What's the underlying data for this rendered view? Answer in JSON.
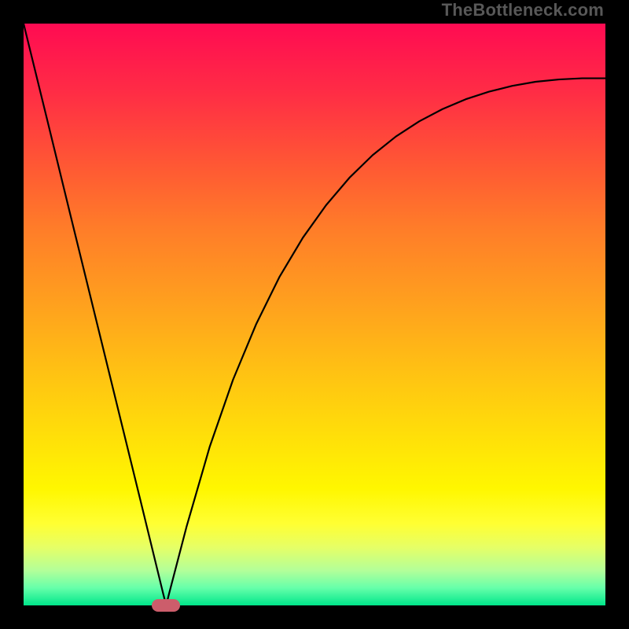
{
  "watermark": "TheBottleneck.com",
  "chart_data": {
    "type": "line",
    "title": "",
    "xlabel": "",
    "ylabel": "",
    "xlim": [
      0,
      100
    ],
    "ylim": [
      0,
      100
    ],
    "grid": false,
    "legend": false,
    "series": [
      {
        "name": "curve",
        "x": [
          0,
          4,
          8,
          12,
          16,
          20,
          24,
          24.5,
          25,
          28,
          32,
          36,
          40,
          44,
          48,
          52,
          56,
          60,
          64,
          68,
          72,
          76,
          80,
          84,
          88,
          92,
          96,
          100
        ],
        "y": [
          100,
          83.7,
          67.3,
          51.0,
          34.7,
          18.4,
          2.0,
          0,
          2.0,
          13.5,
          27.3,
          38.8,
          48.4,
          56.5,
          63.2,
          68.8,
          73.5,
          77.4,
          80.6,
          83.2,
          85.3,
          87.0,
          88.3,
          89.3,
          90.0,
          90.4,
          90.6,
          90.6
        ]
      }
    ],
    "marker": {
      "x": 24.5,
      "y": 0,
      "color": "#cc5d6b",
      "shape": "capsule"
    },
    "background_gradient": {
      "top": "#ff0b52",
      "mid": "#ffd000",
      "bottom": "#00e68a"
    }
  }
}
